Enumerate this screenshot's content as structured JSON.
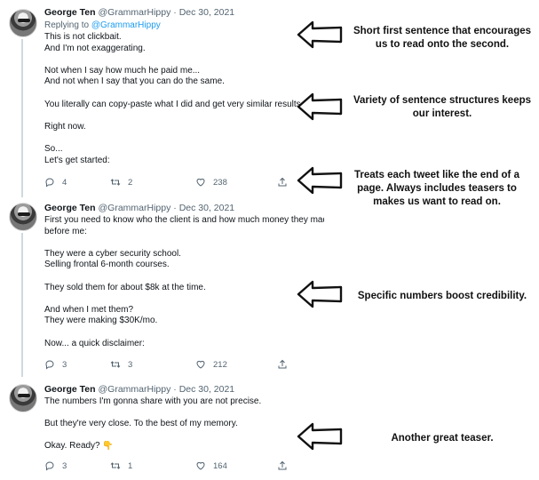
{
  "tweets": [
    {
      "author": "George Ten",
      "handle": "@GrammarHippy",
      "sep": "·",
      "date": "Dec 30, 2021",
      "reply_prefix": "Replying to",
      "reply_to": "@GrammarHippy",
      "lines": [
        "This is not clickbait.",
        "And I'm not exaggerating.",
        "",
        "Not when I say how much he paid me...",
        "And not when I say that you can do the same.",
        "",
        "You literally can copy-paste what I did and get very similar results.",
        "",
        "Right now.",
        "",
        "So...",
        "Let's get started:"
      ],
      "replies": "4",
      "retweets": "2",
      "likes": "238"
    },
    {
      "author": "George Ten",
      "handle": "@GrammarHippy",
      "sep": "·",
      "date": "Dec 30, 2021",
      "lines": [
        "First you need to know who the client is and how much money they made",
        "before me:",
        "",
        "They were a cyber security school.",
        "Selling frontal 6-month courses.",
        "",
        "They sold them for about $8k at the time.",
        "",
        "And when I met them?",
        "They were making $30K/mo.",
        "",
        "Now... a quick disclaimer:"
      ],
      "replies": "3",
      "retweets": "3",
      "likes": "212"
    },
    {
      "author": "George Ten",
      "handle": "@GrammarHippy",
      "sep": "·",
      "date": "Dec 30, 2021",
      "lines": [
        "The numbers I'm gonna share with you are not precise.",
        "",
        "But they're very close. To the best of my memory.",
        "",
        "Okay. Ready? 👇"
      ],
      "replies": "3",
      "retweets": "1",
      "likes": "164"
    }
  ],
  "annotations": [
    "Short first sentence that encourages us to read onto the second.",
    "Variety of sentence structures keeps our interest.",
    "Treats each tweet like the end of a page. Always includes teasers to makes us want to read on.",
    "Specific numbers boost credibility.",
    "Another great teaser."
  ],
  "icons": [
    "reply-icon",
    "retweet-icon",
    "like-icon",
    "share-icon",
    "hand-drawn-arrow-icon"
  ]
}
